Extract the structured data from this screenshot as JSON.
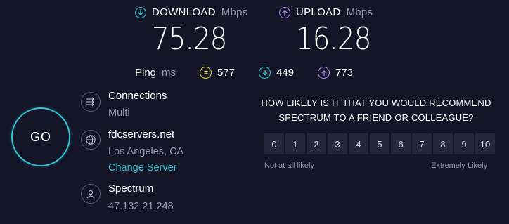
{
  "download": {
    "label": "DOWNLOAD",
    "unit": "Mbps",
    "value": "75.28",
    "icon": "download-arrow-icon",
    "color": "#2ec5d6"
  },
  "upload": {
    "label": "UPLOAD",
    "unit": "Mbps",
    "value": "16.28",
    "icon": "upload-arrow-icon",
    "color": "#b38bf5"
  },
  "ping": {
    "label": "Ping",
    "unit": "ms",
    "idle": {
      "value": "577",
      "icon": "idle-ping-icon",
      "color": "#e6d349"
    },
    "download": {
      "value": "449",
      "icon": "download-ping-icon",
      "color": "#2ec5d6"
    },
    "upload": {
      "value": "773",
      "icon": "upload-ping-icon",
      "color": "#b38bf5"
    }
  },
  "go_button": {
    "label": "GO"
  },
  "connections": {
    "title": "Connections",
    "value": "Multi",
    "icon": "connections-icon"
  },
  "server": {
    "title": "fdcservers.net",
    "location": "Los Angeles, CA",
    "change_label": "Change Server",
    "icon": "globe-icon"
  },
  "isp": {
    "title": "Spectrum",
    "ip": "47.132.21.248",
    "icon": "user-icon"
  },
  "survey": {
    "question_line1": "HOW LIKELY IS IT THAT YOU WOULD RECOMMEND",
    "question_line2": "SPECTRUM TO A FRIEND OR COLLEAGUE?",
    "options": [
      "0",
      "1",
      "2",
      "3",
      "4",
      "5",
      "6",
      "7",
      "8",
      "9",
      "10"
    ],
    "low_label": "Not at all likely",
    "high_label": "Extremely Likely"
  }
}
